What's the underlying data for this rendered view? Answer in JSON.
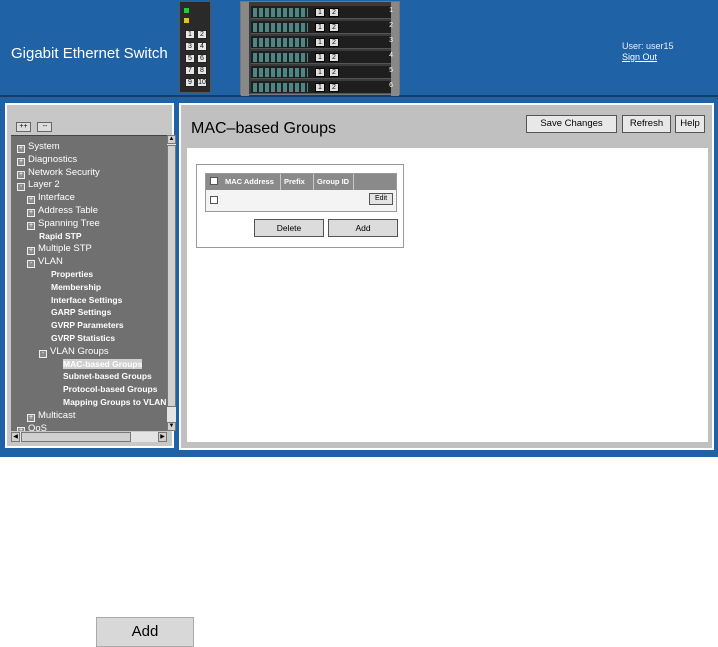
{
  "header": {
    "title": "Gigabit Ethernet Switch",
    "user_label": "User: user15",
    "signout_label": "Sign Out",
    "small_device_ports": [
      "1",
      "2",
      "3",
      "4",
      "5",
      "6",
      "7",
      "8",
      "9",
      "10"
    ],
    "chassis_slots": [
      {
        "ports": [
          "1",
          "2"
        ],
        "num": "1"
      },
      {
        "ports": [
          "1",
          "2"
        ],
        "num": "2"
      },
      {
        "ports": [
          "1",
          "2"
        ],
        "num": "3"
      },
      {
        "ports": [
          "1",
          "2"
        ],
        "num": "4"
      },
      {
        "ports": [
          "1",
          "2"
        ],
        "num": "5"
      },
      {
        "ports": [
          "1",
          "2"
        ],
        "num": "6"
      }
    ]
  },
  "tree": {
    "expand_all_label": "++",
    "collapse_all_label": "--",
    "items": [
      {
        "label": "System",
        "level": 0,
        "toggle": "+",
        "bold": false
      },
      {
        "label": "Diagnostics",
        "level": 0,
        "toggle": "+",
        "bold": false
      },
      {
        "label": "Network Security",
        "level": 0,
        "toggle": "+",
        "bold": false
      },
      {
        "label": "Layer 2",
        "level": 0,
        "toggle": "-",
        "bold": false
      },
      {
        "label": "Interface",
        "level": 1,
        "toggle": "+",
        "bold": false
      },
      {
        "label": "Address Table",
        "level": 1,
        "toggle": "+",
        "bold": false
      },
      {
        "label": "Spanning Tree",
        "level": 1,
        "toggle": "+",
        "bold": false
      },
      {
        "label": "Rapid STP",
        "level": 2,
        "toggle": "",
        "bold": true
      },
      {
        "label": "Multiple STP",
        "level": 1,
        "toggle": "+",
        "bold": false
      },
      {
        "label": "VLAN",
        "level": 1,
        "toggle": "-",
        "bold": false
      },
      {
        "label": "Properties",
        "level": 3,
        "toggle": "",
        "bold": true
      },
      {
        "label": "Membership",
        "level": 3,
        "toggle": "",
        "bold": true
      },
      {
        "label": "Interface Settings",
        "level": 3,
        "toggle": "",
        "bold": true
      },
      {
        "label": "GARP Settings",
        "level": 3,
        "toggle": "",
        "bold": true
      },
      {
        "label": "GVRP Parameters",
        "level": 3,
        "toggle": "",
        "bold": true
      },
      {
        "label": "GVRP Statistics",
        "level": 3,
        "toggle": "",
        "bold": true
      },
      {
        "label": "VLAN Groups",
        "level": 2,
        "toggle": "-",
        "bold": false
      },
      {
        "label": "MAC-based Groups",
        "level": 4,
        "toggle": "",
        "bold": true,
        "selected": true
      },
      {
        "label": "Subnet-based Groups",
        "level": 4,
        "toggle": "",
        "bold": true
      },
      {
        "label": "Protocol-based Groups",
        "level": 4,
        "toggle": "",
        "bold": true
      },
      {
        "label": "Mapping Groups to VLAN",
        "level": 4,
        "toggle": "",
        "bold": true
      },
      {
        "label": "Multicast",
        "level": 1,
        "toggle": "+",
        "bold": false
      },
      {
        "label": "QoS",
        "level": 0,
        "toggle": "+",
        "bold": false
      }
    ]
  },
  "main": {
    "page_title": "MAC–based Groups",
    "save_changes_label": "Save Changes",
    "refresh_label": "Refresh",
    "help_label": "Help",
    "table": {
      "columns": [
        "MAC Address",
        "Prefix",
        "Group ID"
      ],
      "edit_label": "Edit"
    },
    "delete_label": "Delete",
    "add_label": "Add"
  },
  "standalone": {
    "add_label": "Add"
  },
  "colors": {
    "banner": "#1f63a6",
    "panel": "#c0c0c0",
    "tree_bg": "#707070",
    "table_header": "#8a8a8a"
  }
}
